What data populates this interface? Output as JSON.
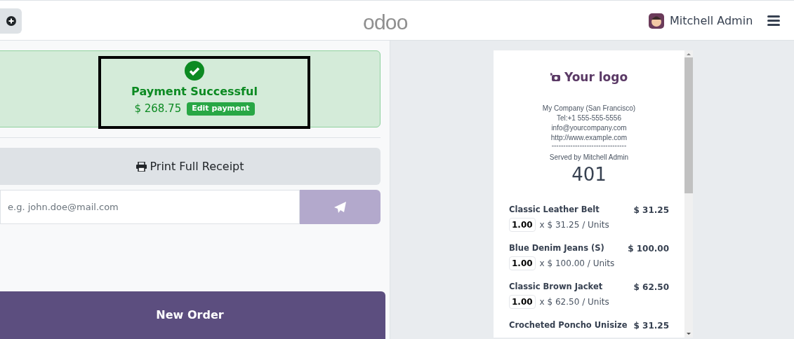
{
  "header": {
    "logo": "odoo",
    "user": "Mitchell Admin"
  },
  "payment": {
    "status": "Payment Successful",
    "amount": "$ 268.75",
    "edit_button": "Edit payment"
  },
  "print_button": "Print Full Receipt",
  "email": {
    "placeholder": "e.g. john.doe@mail.com"
  },
  "new_order_button": "New Order",
  "receipt": {
    "logo": "Your logo",
    "company_lines": [
      "My Company (San Francisco)",
      "Tel:+1 555-555-5556",
      "info@yourcompany.com",
      "http://www.example.com"
    ],
    "separator": "--------------------------------",
    "served_by": "Served by Mitchell Admin",
    "order_number": "401",
    "lines": [
      {
        "product": "Classic Leather Belt",
        "total": "$ 31.25",
        "qty": "1.00",
        "unit_price": "x $ 31.25 / Units"
      },
      {
        "product": "Blue Denim Jeans (S)",
        "total": "$ 100.00",
        "qty": "1.00",
        "unit_price": "x $ 100.00 / Units"
      },
      {
        "product": "Classic Brown Jacket",
        "total": "$ 62.50",
        "qty": "1.00",
        "unit_price": "x $ 62.50 / Units"
      },
      {
        "product": "Crocheted Poncho Unisize",
        "total": "$ 31.25"
      }
    ]
  }
}
